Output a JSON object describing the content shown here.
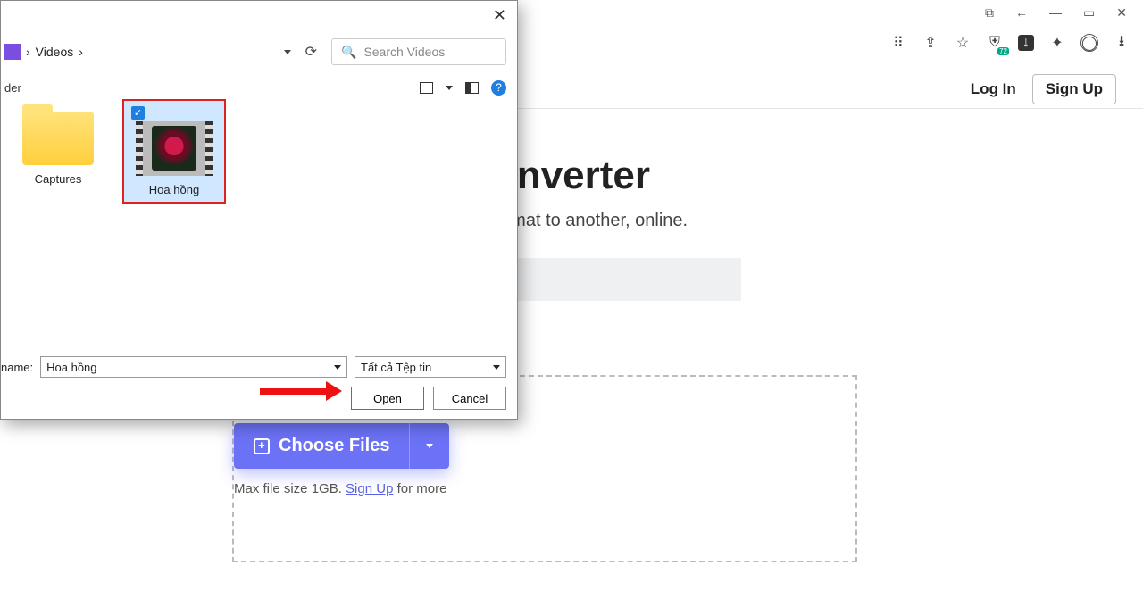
{
  "window": {
    "controls": [
      "⧉",
      "←",
      "—",
      "▭",
      "✕"
    ]
  },
  "browserBar": {
    "badge": "72"
  },
  "page": {
    "login": "Log In",
    "signup": "Sign Up",
    "title_fragment": "onverter",
    "subtitle_fragment": "  one format to another, online.",
    "choose": "Choose Files",
    "hint_pre": "Max file size 1GB. ",
    "hint_link": "Sign Up",
    "hint_post": " for more"
  },
  "dialog": {
    "breadcrumb": {
      "folder": "Videos"
    },
    "search_placeholder": "Search Videos",
    "toolbar_left": "der",
    "items": {
      "captures": "Captures",
      "selected": "Hoa hồng"
    },
    "filename_label": "name:",
    "filename_value": "Hoa hồng",
    "filetype": "Tất cả Tệp tin",
    "open": "Open",
    "cancel": "Cancel"
  }
}
